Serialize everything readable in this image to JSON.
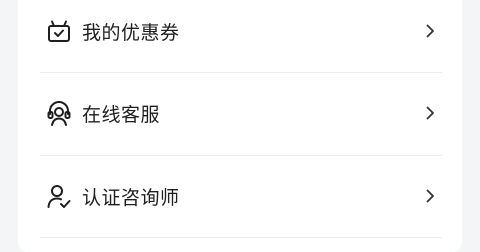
{
  "menu": {
    "items": [
      {
        "label": "我的优惠券",
        "icon": "coupon-gift-icon"
      },
      {
        "label": "在线客服",
        "icon": "customer-service-headset-icon"
      },
      {
        "label": "认证咨询师",
        "icon": "verified-user-icon"
      }
    ]
  },
  "colors": {
    "text": "#1f1f1f",
    "icon": "#1f1f1f",
    "chevron": "#333333",
    "divider": "#ececec",
    "background": "#f4f5f7",
    "card": "#ffffff"
  }
}
